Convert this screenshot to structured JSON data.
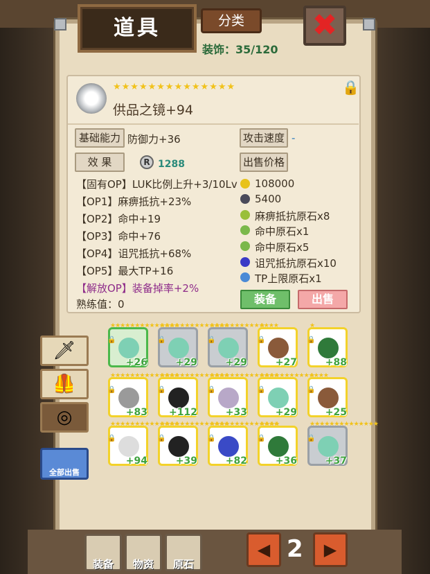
{
  "header": {
    "title": "道具",
    "sort_label": "分类",
    "close": "✖",
    "decoration_label": "装饰：35/120"
  },
  "item": {
    "stars": "★★★★★★★★★★★★★★",
    "name": "供品之镜+94",
    "basic_label": "基础能力",
    "basic_value": "防御力+36",
    "atk_speed_label": "攻击速度",
    "atk_speed_value": "-",
    "effect_label": "效 果",
    "r_icon": "R",
    "r_value": "1288",
    "sell_price_label": "出售价格",
    "ops": [
      "【固有OP】LUK比例上升+3/10Lv",
      "【OP1】麻痹抵抗+23%",
      "【OP2】命中+19",
      "【OP3】命中+76",
      "【OP4】诅咒抵抗+68%",
      "【OP5】最大TP+16"
    ],
    "unlock_op": "【解放OP】装备掉率+2%",
    "proficiency": "熟练值：0",
    "prices": [
      {
        "text": "108000",
        "color": "#e8c21a"
      },
      {
        "text": "5400",
        "color": "#4a4a5a"
      },
      {
        "text": "麻痹抵抗原石x8",
        "color": "#9abf3a"
      },
      {
        "text": "命中原石x1",
        "color": "#7ab84a"
      },
      {
        "text": "命中原石x5",
        "color": "#7ab84a"
      },
      {
        "text": "诅咒抵抗原石x10",
        "color": "#3a3ac6"
      },
      {
        "text": "TP上限原石x1",
        "color": "#4a8ad6"
      }
    ],
    "equip_label": "装备",
    "sell_label": "出售"
  },
  "side": {
    "tabs": [
      "sword-icon",
      "armor-icon",
      "accessory-icon"
    ],
    "sell_all_label": "全部出售"
  },
  "grid": [
    {
      "stars": "★★★★★★★★★★★★★★",
      "lvl": "+26",
      "gem": "#7ed0b4",
      "style": "sel"
    },
    {
      "stars": "★★★★★★★★★★★★★★",
      "lvl": "+29",
      "gem": "#7ed0b4",
      "style": "gray"
    },
    {
      "stars": "★★★★★★★★★★★★★★",
      "lvl": "+29",
      "gem": "#7ed0b4",
      "style": "gray"
    },
    {
      "stars": "★",
      "lvl": "+27",
      "gem": "#8a5a3a",
      "style": ""
    },
    {
      "stars": "★",
      "lvl": "+88",
      "gem": "#2f7a3a",
      "style": ""
    },
    {
      "stars": "★★★★★★★★★★★★★★",
      "lvl": "+83",
      "gem": "#9a9a9a",
      "style": ""
    },
    {
      "stars": "★★★★★★★★★★★★★★",
      "lvl": "+112",
      "gem": "#222222",
      "style": ""
    },
    {
      "stars": "★★★★★★★★★★★★★★",
      "lvl": "+33",
      "gem": "#b8a8c8",
      "style": ""
    },
    {
      "stars": "★★★★★★★★★★★★★★",
      "lvl": "+29",
      "gem": "#7ed0b4",
      "style": ""
    },
    {
      "stars": "★",
      "lvl": "+25",
      "gem": "#8a5a3a",
      "style": ""
    },
    {
      "stars": "★★★★★★★★★★★★★★",
      "lvl": "+94",
      "gem": "#dddddd",
      "style": ""
    },
    {
      "stars": "★★★★★★★★★★★★★★",
      "lvl": "+39",
      "gem": "#222222",
      "style": ""
    },
    {
      "stars": "★★★★★★★★★★★★★★",
      "lvl": "+82",
      "gem": "#3a4ac6",
      "style": ""
    },
    {
      "stars": "★★★★",
      "lvl": "+36",
      "gem": "#2f7a3a",
      "style": ""
    },
    {
      "stars": "★★★★★★★★★★★★★★",
      "lvl": "+37",
      "gem": "#7ed0b4",
      "style": "gray"
    }
  ],
  "bottom": {
    "equip": "装备",
    "materials": "物资",
    "ore": "原石",
    "page": "2",
    "prev": "◀",
    "next": "▶"
  },
  "colors": {
    "panel": "#e9dcc1",
    "accent_green": "#3fa33f",
    "close_red": "#e32424"
  }
}
